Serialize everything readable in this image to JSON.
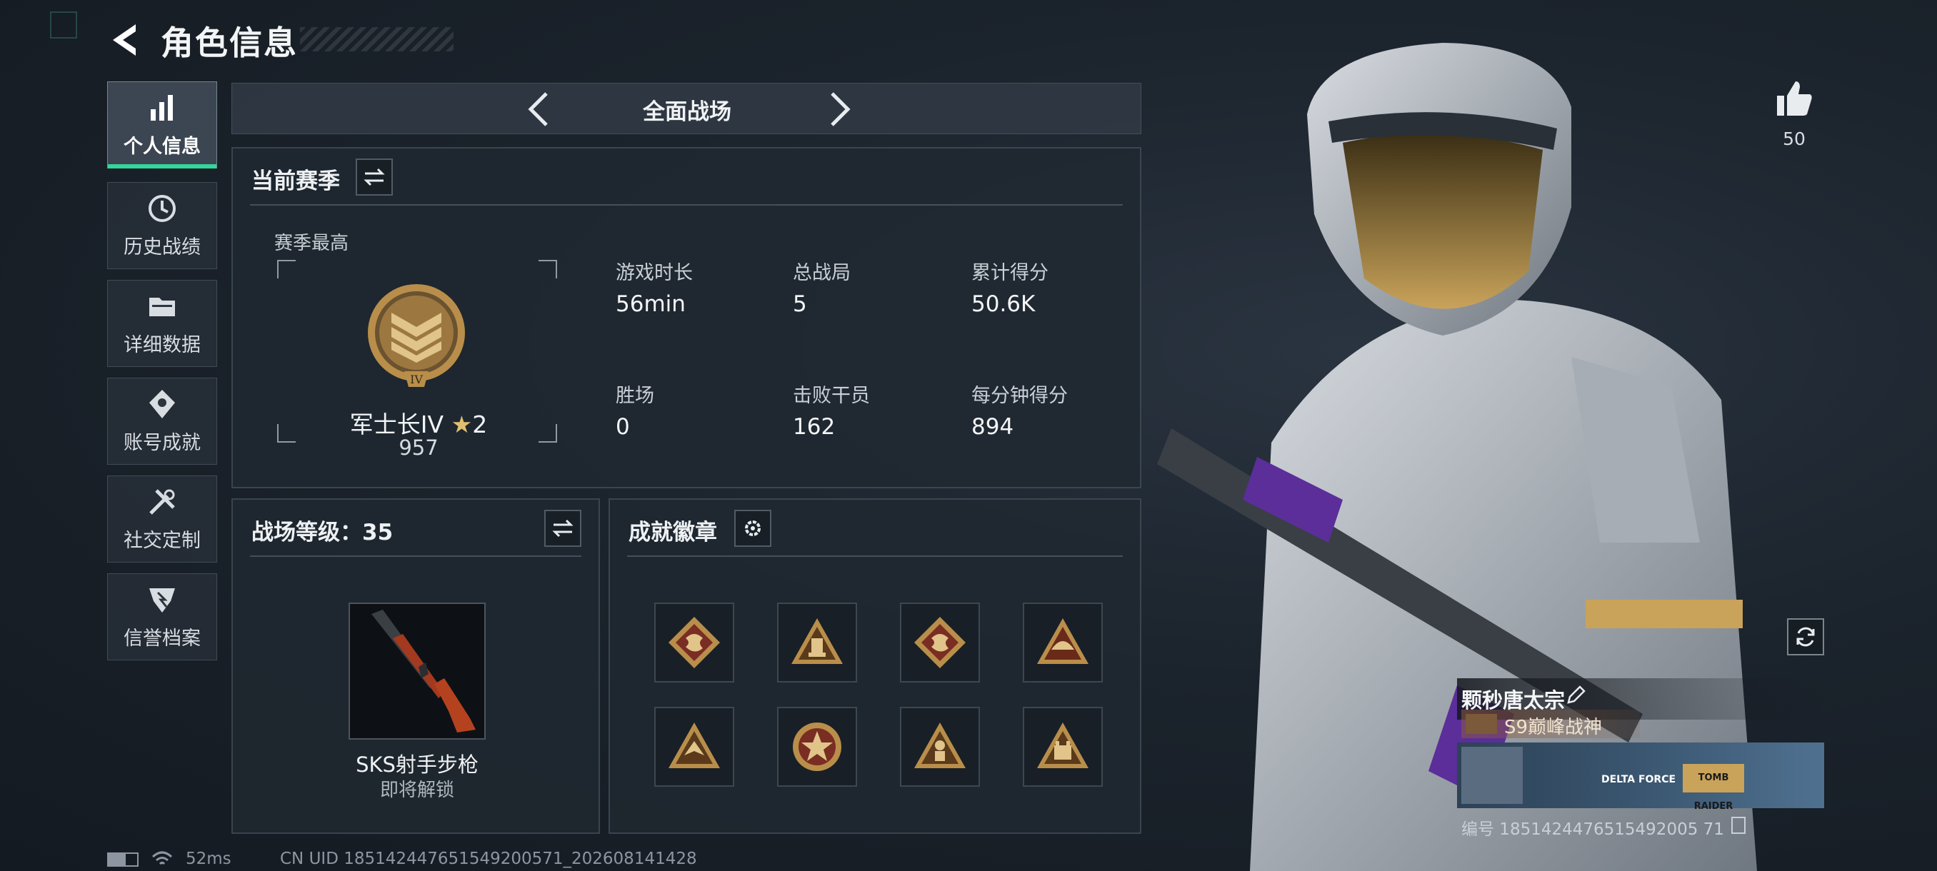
{
  "header": {
    "title": "角色信息"
  },
  "nav": [
    {
      "label": "个人信息",
      "icon": "bar-chart-icon",
      "active": true
    },
    {
      "label": "历史战绩",
      "icon": "history-icon",
      "active": false
    },
    {
      "label": "详细数据",
      "icon": "folder-icon",
      "active": false
    },
    {
      "label": "账号成就",
      "icon": "achievement-icon",
      "active": false
    },
    {
      "label": "社交定制",
      "icon": "tools-icon",
      "active": false
    },
    {
      "label": "信誉档案",
      "icon": "credit-icon",
      "active": false
    }
  ],
  "mode": {
    "label": "全面战场"
  },
  "season": {
    "title": "当前赛季",
    "best_label": "赛季最高",
    "rank_name": "军士长IV",
    "rank_stars": "2",
    "rank_points": "957",
    "rank_numeral": "IV",
    "stats": [
      {
        "label": "游戏时长",
        "value": "56min"
      },
      {
        "label": "总战局",
        "value": "5"
      },
      {
        "label": "累计得分",
        "value": "50.6K"
      },
      {
        "label": "胜场",
        "value": "0"
      },
      {
        "label": "击败干员",
        "value": "162"
      },
      {
        "label": "每分钟得分",
        "value": "894"
      }
    ]
  },
  "battle_level": {
    "title": "战场等级：35",
    "weapon_name": "SKS射手步枪",
    "weapon_status": "即将解锁"
  },
  "badges": {
    "title": "成就徽章",
    "items": [
      "dragon-badge-icon",
      "tank-badge-icon",
      "dragon-badge-icon",
      "helmet-badge-icon",
      "eagle-badge-icon",
      "star-medal-icon",
      "soldier-badge-icon",
      "fortress-badge-icon"
    ]
  },
  "profile": {
    "likes": "50",
    "player_name": "颗秒唐太宗",
    "title_badge": "S9巅峰战神",
    "banner_text_1": "DELTA FORCE",
    "banner_text_2": "TOMB RAIDER",
    "id_line": "编号 1851424476515492005 71"
  },
  "status_bar": {
    "ping": "52ms",
    "uid": "CN UID 185142447651549200571_202608141428"
  },
  "colors": {
    "accent": "#33d69a",
    "gold": "#c9a35a"
  }
}
